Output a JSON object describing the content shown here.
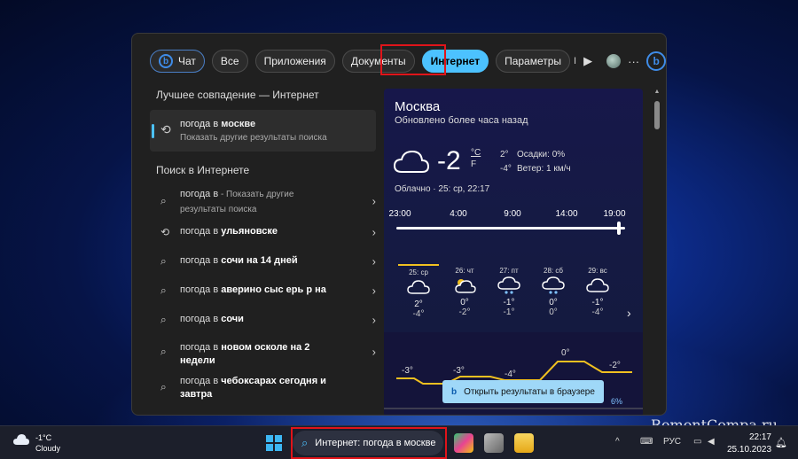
{
  "panel": {
    "tabs": [
      {
        "label": "Чат"
      },
      {
        "label": "Все"
      },
      {
        "label": "Приложения"
      },
      {
        "label": "Документы"
      },
      {
        "label": "Интернет",
        "active": true
      },
      {
        "label": "Параметры"
      }
    ],
    "tab_overflow_char": "I"
  },
  "results": {
    "best_match_heading": "Лучшее совпадение — Интернет",
    "best_match": {
      "prefix": "погода в ",
      "bold": "москве",
      "subtitle": "Показать другие результаты поиска",
      "icon": "history-icon"
    },
    "web_heading": "Поиск в Интернете",
    "items": [
      {
        "prefix": "погода в",
        "bold": "",
        "suffix": " - Показать другие результаты поиска",
        "icon": "search-icon"
      },
      {
        "prefix": "погода в ",
        "bold": "ульяновске",
        "suffix": "",
        "icon": "history-icon"
      },
      {
        "prefix": "погода в ",
        "bold": "сочи на 14 дней",
        "suffix": "",
        "icon": "search-icon"
      },
      {
        "prefix": "погода в ",
        "bold": "аверино сыс ерь р на",
        "suffix": "",
        "icon": "search-icon"
      },
      {
        "prefix": "погода в ",
        "bold": "сочи",
        "suffix": "",
        "icon": "search-icon"
      },
      {
        "prefix": "погода в ",
        "bold": "новом осколе на 2 недели",
        "suffix": "",
        "icon": "search-icon"
      },
      {
        "prefix": "погода в ",
        "bold": "чебоксарах сегодня и завтра",
        "suffix": "",
        "icon": "search-icon"
      }
    ]
  },
  "weather": {
    "city": "Москва",
    "updated": "Обновлено более часа назад",
    "temp": "-2",
    "unit_c": "°C",
    "unit_f": "F",
    "high": "2°",
    "low": "-4°",
    "precip": "Осадки: 0%",
    "wind": "Ветер: 1 км/ч",
    "condition": "Облачно · 25: ср, 22:17",
    "hours": [
      "23:00",
      "4:00",
      "9:00",
      "14:00",
      "19:00"
    ],
    "days": [
      {
        "label": "25: ср",
        "icon": "cloud-icon",
        "hi": "2°",
        "lo": "-4°",
        "selected": true
      },
      {
        "label": "26: чт",
        "icon": "partly-sunny-icon",
        "hi": "0°",
        "lo": "-2°"
      },
      {
        "label": "27: пт",
        "icon": "snow-cloud-icon",
        "hi": "-1°",
        "lo": "-1°"
      },
      {
        "label": "28: сб",
        "icon": "snow-cloud-icon",
        "hi": "0°",
        "lo": "0°"
      },
      {
        "label": "29: вс",
        "icon": "cloud-icon",
        "hi": "-1°",
        "lo": "-4°"
      }
    ],
    "chart_labels": [
      "-3°",
      "-3°",
      "-4°",
      "0°",
      "-2°"
    ],
    "precip_label": "6%",
    "open_browser": "Открыть результаты в браузере"
  },
  "taskbar": {
    "weather_temp": "-1°C",
    "weather_text": "Cloudy",
    "search_text": "Интернет: погода в москве",
    "lang": "РУС",
    "time": "22:17",
    "date": "25.10.2023"
  },
  "watermark": "RemontCompa.ru",
  "colors": {
    "accent": "#4cc2ff",
    "highlight_box": "#e0141a",
    "chart_line": "#f0c020"
  }
}
